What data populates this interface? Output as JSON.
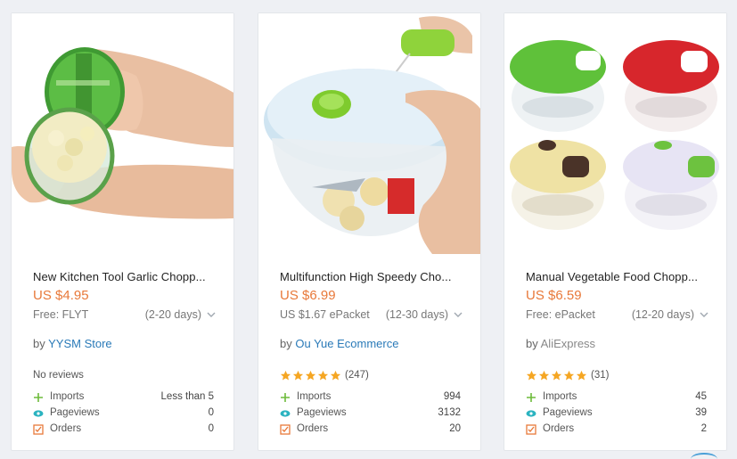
{
  "products": [
    {
      "title": "New Kitchen Tool Garlic Chopp...",
      "price": "US $4.95",
      "shipping_method": "Free: FLYT",
      "shipping_days": "(2-20 days)",
      "seller_prefix": "by",
      "seller": "YYSM Store",
      "rating_text": "No reviews",
      "stars": 0,
      "stats": {
        "imports_label": "Imports",
        "imports_value": "Less than 5",
        "pageviews_label": "Pageviews",
        "pageviews_value": "0",
        "orders_label": "Orders",
        "orders_value": "0"
      }
    },
    {
      "title": "Multifunction High Speedy Cho...",
      "price": "US $6.99",
      "shipping_method": "US $1.67 ePacket",
      "shipping_days": "(12-30 days)",
      "seller_prefix": "by",
      "seller": "Ou Yue Ecommerce",
      "rating_text": "(247)",
      "stars": 5,
      "stats": {
        "imports_label": "Imports",
        "imports_value": "994",
        "pageviews_label": "Pageviews",
        "pageviews_value": "3132",
        "orders_label": "Orders",
        "orders_value": "20"
      }
    },
    {
      "title": "Manual Vegetable Food Chopp...",
      "price": "US $6.59",
      "shipping_method": "Free: ePacket",
      "shipping_days": "(12-20 days)",
      "seller_prefix": "by",
      "seller": "AliExpress",
      "rating_text": "(31)",
      "stars": 5,
      "stats": {
        "imports_label": "Imports",
        "imports_value": "45",
        "pageviews_label": "Pageviews",
        "pageviews_value": "39",
        "orders_label": "Orders",
        "orders_value": "2"
      }
    }
  ],
  "colors": {
    "price": "#e8793a",
    "link": "#2a7ab8",
    "star": "#f5a623",
    "imports_icon": "#6dbb3a",
    "pageviews_icon": "#2bb3c0",
    "orders_icon": "#e8793a"
  },
  "icons": {
    "imports": "plus-icon",
    "pageviews": "eye-icon",
    "orders": "checklist-icon",
    "shipping": "chevron-down-icon"
  }
}
